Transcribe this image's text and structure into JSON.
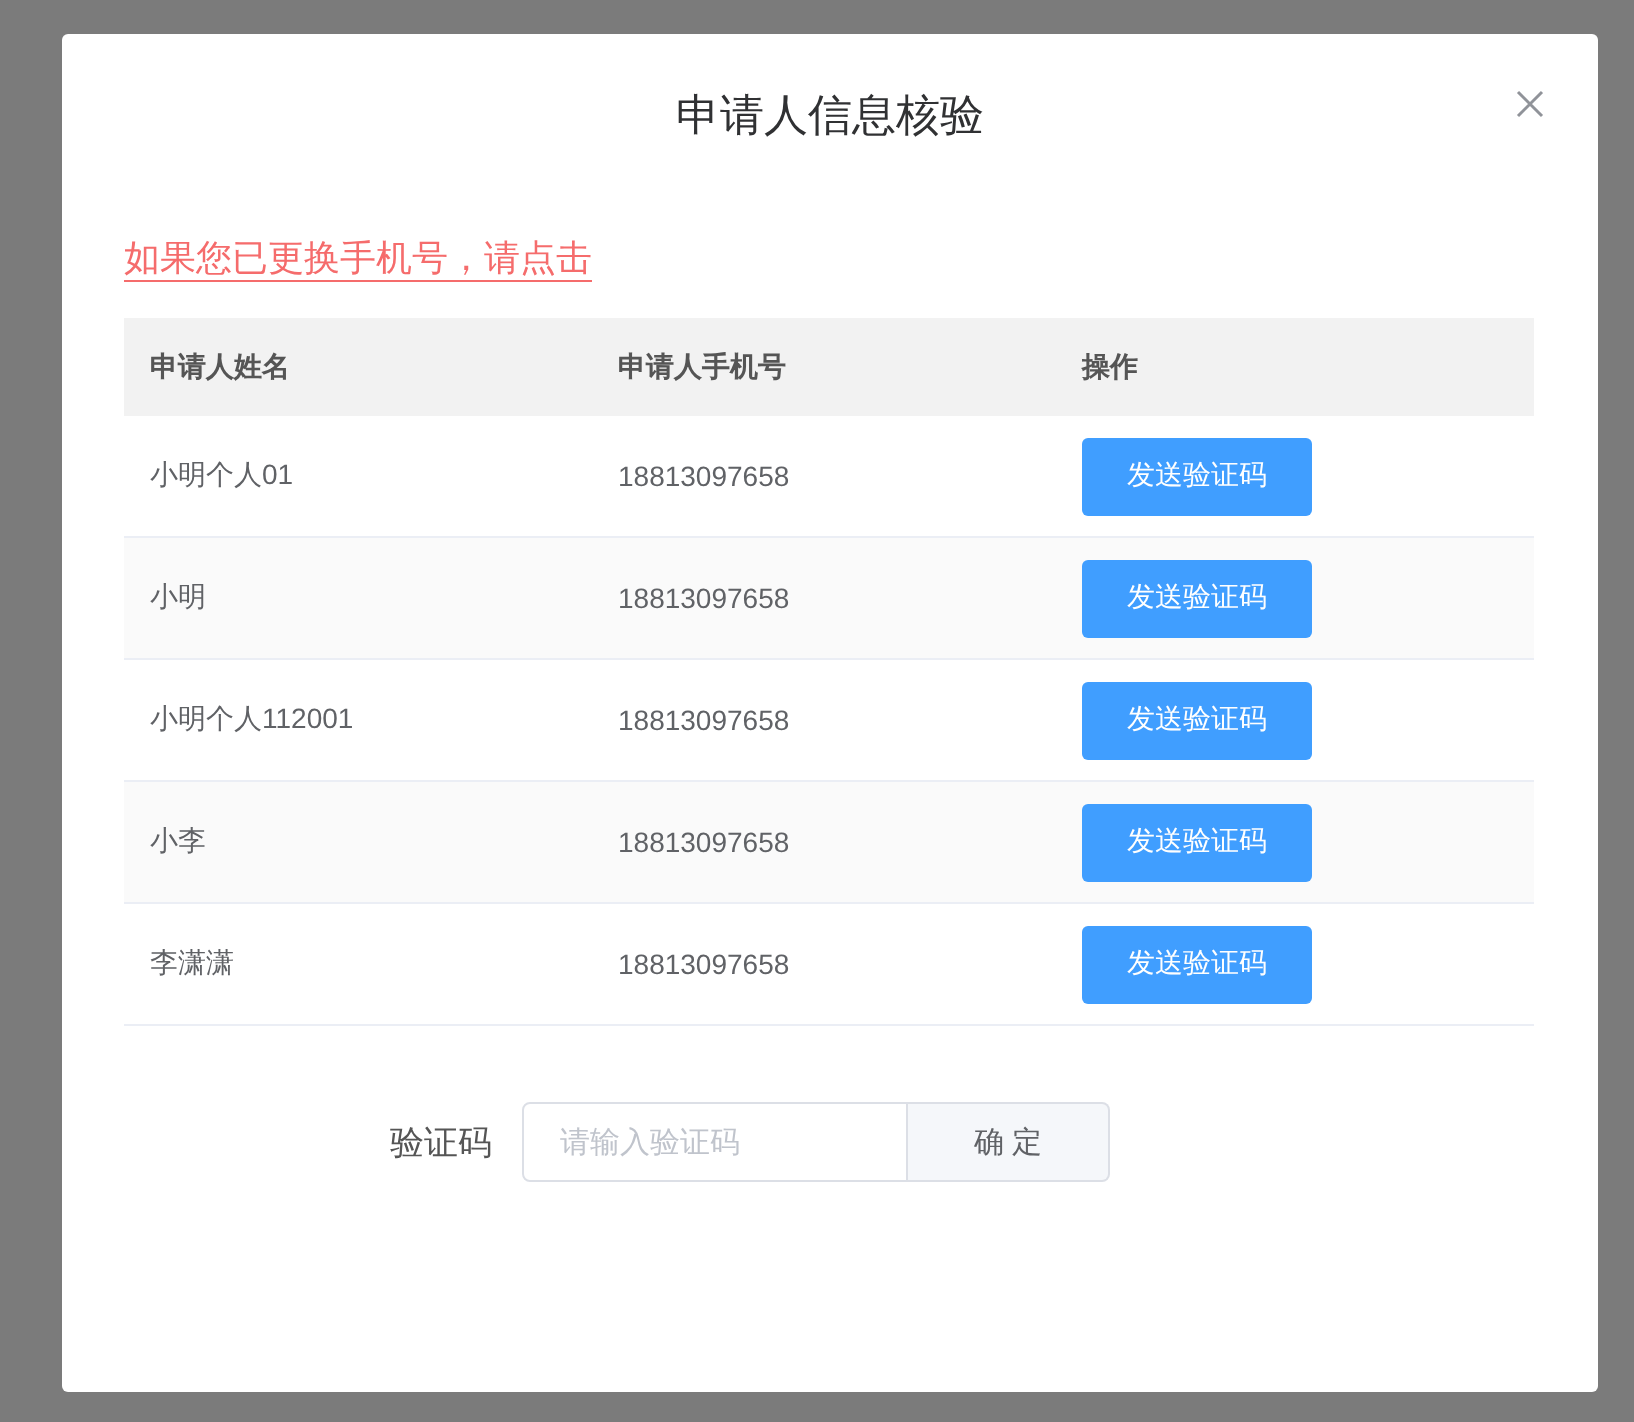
{
  "dialog": {
    "title": "申请人信息核验",
    "notice_link": "如果您已更换手机号，请点击"
  },
  "table": {
    "columns": [
      "申请人姓名",
      "申请人手机号",
      "操作"
    ],
    "rows": [
      {
        "name": "小明个人01",
        "phone": "18813097658",
        "action": "发送验证码"
      },
      {
        "name": "小明",
        "phone": "18813097658",
        "action": "发送验证码"
      },
      {
        "name": "小明个人112001",
        "phone": "18813097658",
        "action": "发送验证码"
      },
      {
        "name": "小李",
        "phone": "18813097658",
        "action": "发送验证码"
      },
      {
        "name": "李潇潇",
        "phone": "18813097658",
        "action": "发送验证码"
      }
    ]
  },
  "verify": {
    "label": "验证码",
    "placeholder": "请输入验证码",
    "button": "确 定"
  }
}
